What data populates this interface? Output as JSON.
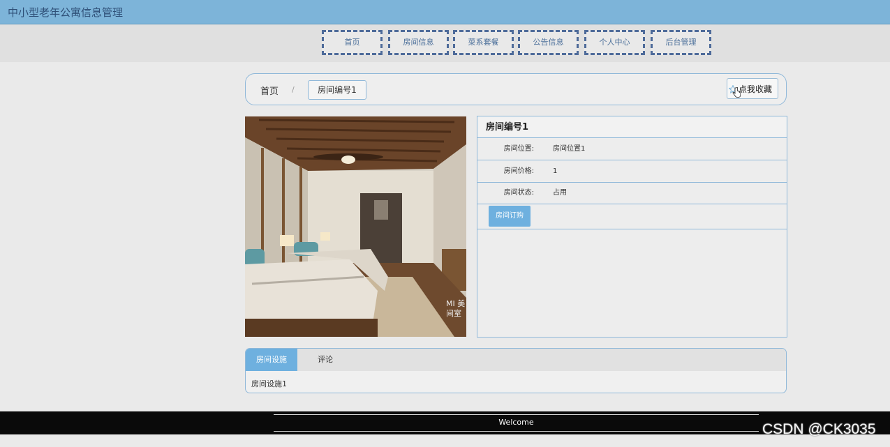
{
  "header": {
    "site_title": "中小型老年公寓信息管理"
  },
  "nav": {
    "items": [
      {
        "label": "首页"
      },
      {
        "label": "房间信息"
      },
      {
        "label": "菜系套餐"
      },
      {
        "label": "公告信息"
      },
      {
        "label": "个人中心"
      },
      {
        "label": "后台管理"
      }
    ]
  },
  "breadcrumb": {
    "home": "首页",
    "separator": "/",
    "current": "房间编号1"
  },
  "favorite_button": {
    "label": "点我收藏"
  },
  "room": {
    "title": "房间编号1",
    "fields": [
      {
        "label": "房间位置:",
        "value": "房间位置1"
      },
      {
        "label": "房间价格:",
        "value": "1"
      },
      {
        "label": "房间状态:",
        "value": "占用"
      }
    ],
    "order_button": "房间订购",
    "image_watermark": "MI 美间室"
  },
  "tabs": {
    "items": [
      {
        "label": "房间设施",
        "active": true
      },
      {
        "label": "评论",
        "active": false
      }
    ],
    "content": "房间设施1"
  },
  "footer": {
    "text": "Welcome"
  },
  "watermark": "CSDN @CK3035",
  "colors": {
    "topbar": "#7db4d9",
    "accent": "#6eb0df",
    "nav_border": "#4e6b9a",
    "footer": "#0a0a0a"
  }
}
